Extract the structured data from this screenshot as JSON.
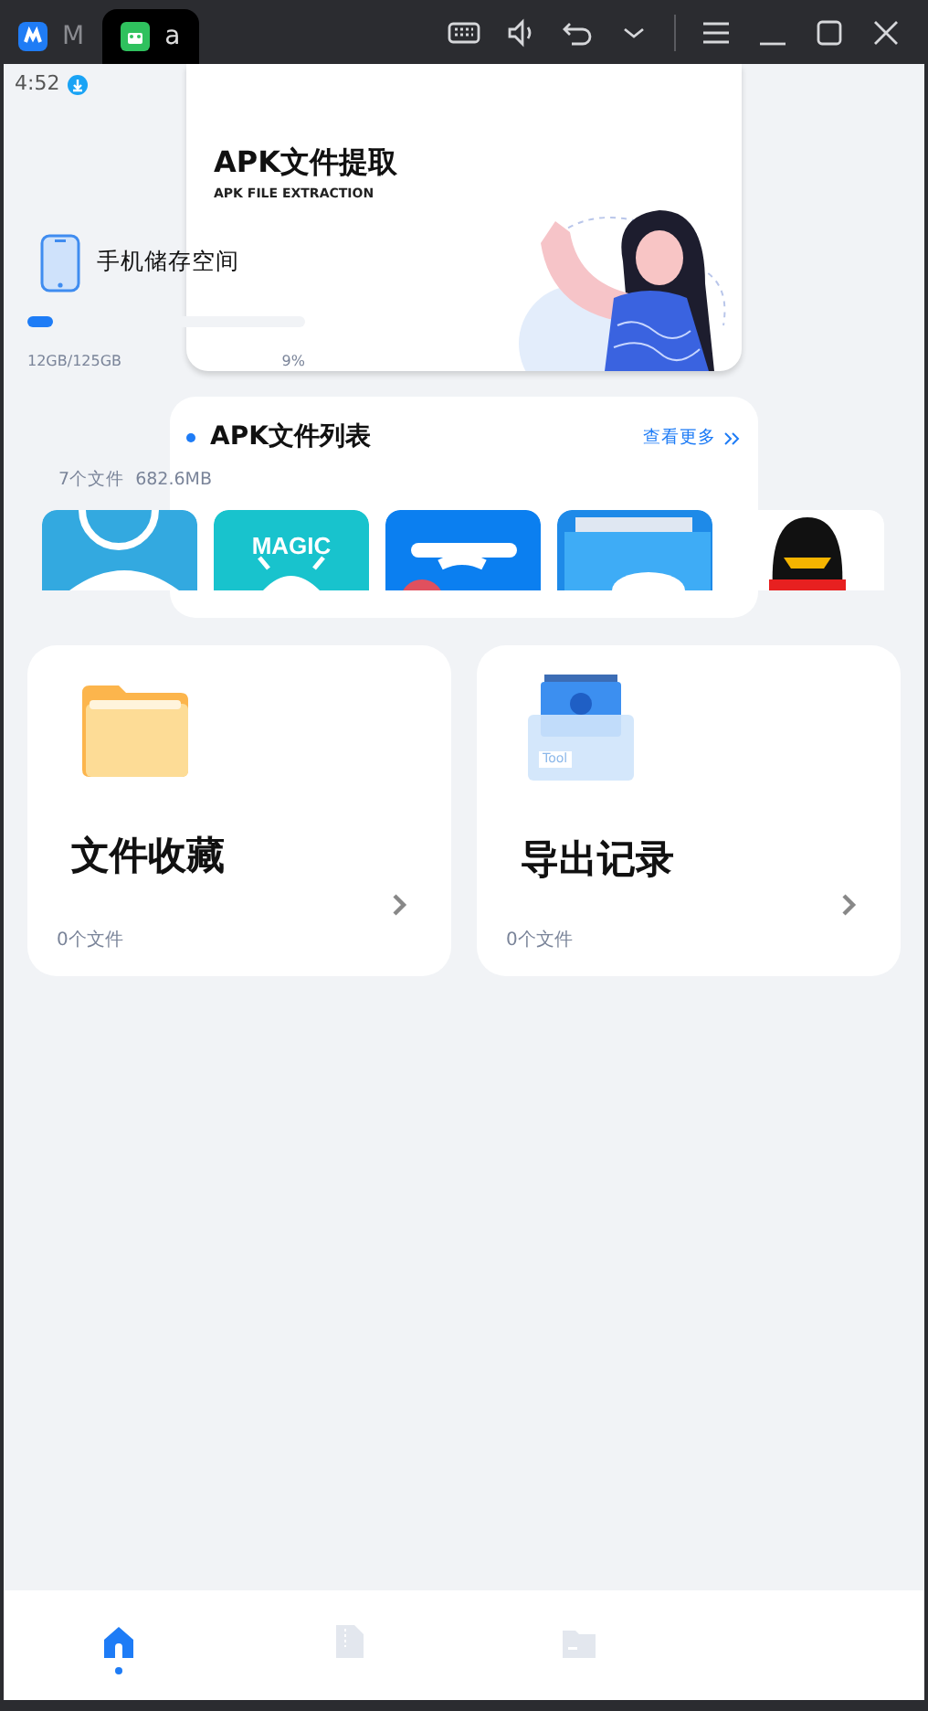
{
  "window": {
    "tabs": [
      {
        "label": "M",
        "selected": false
      },
      {
        "label": "a",
        "selected": true
      }
    ]
  },
  "status_bar": {
    "time": "4:52"
  },
  "banner": {
    "title": "APK文件提取",
    "subtitle": "APK FILE EXTRACTION"
  },
  "storage": {
    "label": "手机储存空间",
    "level": 0.09,
    "usage": "12GB/125GB",
    "percent": "9%"
  },
  "apk_list": {
    "title": "APK文件列表",
    "more": "查看更多",
    "summary": "7个文件  682.6MB",
    "apps": [
      {
        "kind": "contacts"
      },
      {
        "kind": "magic",
        "icon_text": "MAGIC"
      },
      {
        "kind": "scissors"
      },
      {
        "kind": "folder"
      },
      {
        "kind": "penguin"
      }
    ]
  },
  "cards": [
    {
      "kind": "folder",
      "title": "文件收藏",
      "count": "0个文件"
    },
    {
      "kind": "toolbox",
      "title": "导出记录",
      "count": "0个文件",
      "icon_text": "Tool"
    }
  ],
  "nav": [
    {
      "kind": "home",
      "selected": true
    },
    {
      "kind": "zip",
      "selected": false
    },
    {
      "kind": "folder",
      "selected": false
    }
  ]
}
